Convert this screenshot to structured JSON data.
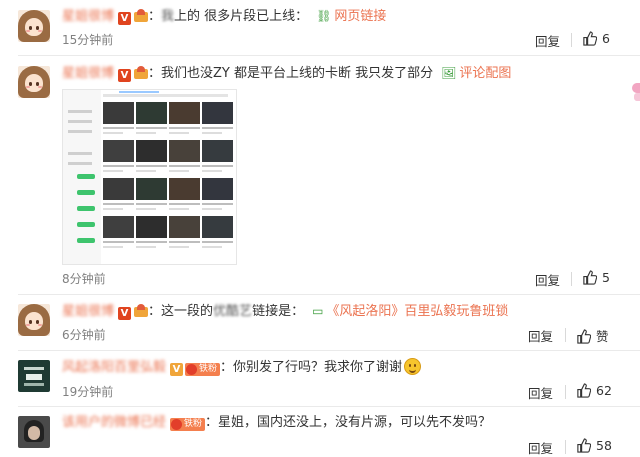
{
  "comments": [
    {
      "user": "星姐很博",
      "text": "上的 很多片段已上线：",
      "text_blur_prefix": "我",
      "link_label": "网页链接",
      "time": "15分钟前",
      "reply": "回复",
      "likes": "6"
    },
    {
      "user": "星姐很博",
      "text": "我们也没ZY 都是平台上线的卡断 我只发了部分",
      "link_label": "评论配图",
      "time": "8分钟前",
      "reply": "回复",
      "likes": "5"
    },
    {
      "user": "星姐很博",
      "text_prefix": "这一段的",
      "text_blur": "优酷艺",
      "text_suffix": "链接是：",
      "link_label": "《风起洛阳》百里弘毅玩鲁班锁",
      "time": "6分钟前",
      "reply": "回复",
      "likes": "赞"
    },
    {
      "user": "风起洛阳百里弘毅",
      "fan_badge": "铁粉",
      "text": "你别发了行吗？我求你了谢谢",
      "time": "19分钟前",
      "reply": "回复",
      "likes": "62"
    },
    {
      "user": "该用户的微博已经",
      "fan_badge": "铁粉",
      "text": "星姐，国内还没上，没有片源，可以先不发吗？",
      "time": "19分钟前",
      "reply": "回复",
      "likes": "58"
    }
  ],
  "icons": {
    "verified": "V",
    "link": "link-icon",
    "image": "image-icon",
    "like": "thumbs-up-icon"
  },
  "colors": {
    "username": "#eb7350",
    "link": "#eb7350",
    "link_icon": "#3b9c3b",
    "verified_badge": "#e0441f",
    "fan_badge": "#f47f4e"
  }
}
